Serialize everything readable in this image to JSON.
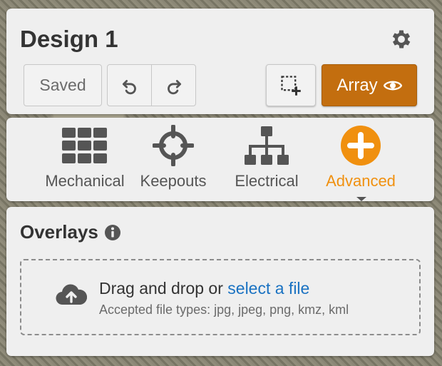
{
  "header": {
    "title": "Design 1",
    "saved_label": "Saved",
    "array_label": "Array",
    "accent_color": "#c36e0f"
  },
  "icons": {
    "settings": "gear-icon",
    "undo": "undo-icon",
    "redo": "redo-icon",
    "select": "selection-add-icon",
    "visibility": "eye-icon"
  },
  "tabs": [
    {
      "label": "Mechanical",
      "icon": "grid-icon",
      "active": false
    },
    {
      "label": "Keepouts",
      "icon": "crosshair-icon",
      "active": false
    },
    {
      "label": "Electrical",
      "icon": "hierarchy-icon",
      "active": false
    },
    {
      "label": "Advanced",
      "icon": "plus-circle-icon",
      "active": true,
      "color": "#f0900f"
    }
  ],
  "overlays": {
    "title": "Overlays",
    "drop_text": "Drag and drop or",
    "select_link": "select a file",
    "accepted_types": "Accepted file types: jpg, jpeg, png, kmz, kml"
  }
}
